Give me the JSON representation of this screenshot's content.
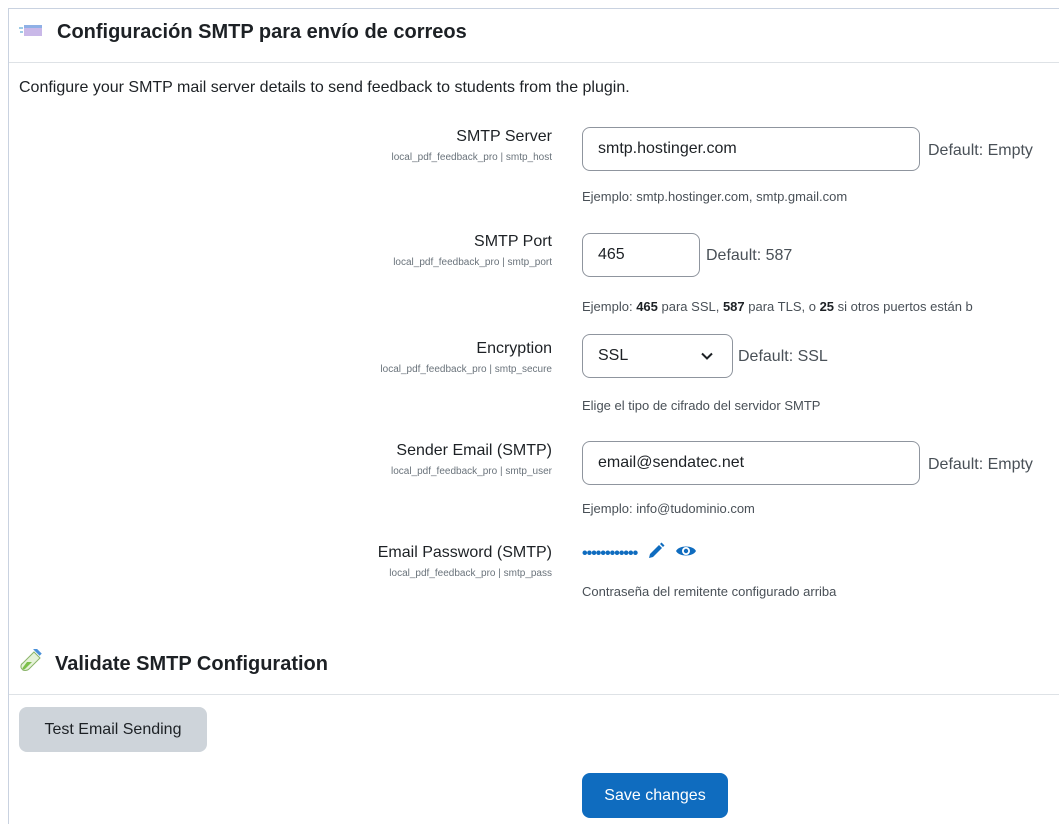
{
  "section1": {
    "title": "Configuración SMTP para envío de correos",
    "icon": "envelope-icon"
  },
  "intro": "Configure your SMTP mail server details to send feedback to students from the plugin.",
  "fields": [
    {
      "label": "SMTP Server",
      "setting": "local_pdf_feedback_pro | smtp_host",
      "value": "smtp.hostinger.com",
      "default": "Default: Empty",
      "help": "Ejemplo: smtp.hostinger.com, smtp.gmail.com"
    },
    {
      "label": "SMTP Port",
      "setting": "local_pdf_feedback_pro | smtp_port",
      "value": "465",
      "default": "Default: 587",
      "help_parts": [
        "Ejemplo: ",
        "465",
        " para SSL, ",
        "587",
        " para TLS, o ",
        "25",
        " si otros puertos están b"
      ]
    },
    {
      "label": "Encryption",
      "setting": "local_pdf_feedback_pro | smtp_secure",
      "value": "SSL",
      "default": "Default: SSL",
      "help": "Elige el tipo de cifrado del servidor SMTP"
    },
    {
      "label": "Sender Email (SMTP)",
      "setting": "local_pdf_feedback_pro | smtp_user",
      "value": "email@sendatec.net",
      "default": "Default: Empty",
      "help": "Ejemplo: info@tudominio.com"
    },
    {
      "label": "Email Password (SMTP)",
      "setting": "local_pdf_feedback_pro | smtp_pass",
      "value": "••••••••••••",
      "help": "Contraseña del remitente configurado arriba"
    }
  ],
  "section2": {
    "title": "Validate SMTP Configuration",
    "icon": "test-tube-icon"
  },
  "buttons": {
    "test": "Test Email Sending",
    "save": "Save changes"
  },
  "colors": {
    "primary": "#0f6cbf",
    "secondary": "#ced4da"
  }
}
